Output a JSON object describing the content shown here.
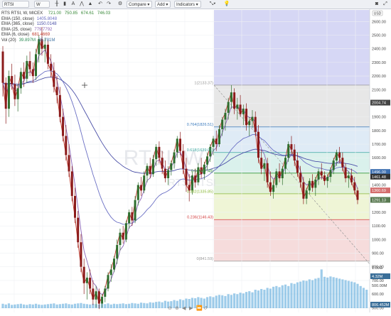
{
  "toolbar": {
    "symbol": "RTSI",
    "interval": "W",
    "compare_label": "Compare",
    "add_label": "Add",
    "indicators_label": "Indicators"
  },
  "chart_title": {
    "name": "RTS RTSI, W, MICEX",
    "open": "721.00",
    "high": "750.85",
    "low": "674.61",
    "close": "746.03"
  },
  "watermark": "RTSI, W",
  "watermark2": "RTS RTSI",
  "price_axis_badge": "USD",
  "chart_data": {
    "type": "candlestick",
    "price_axis": {
      "range": [
        465,
        2685
      ],
      "ticks": [
        2600,
        2500,
        2400,
        2300,
        2200,
        2100,
        2000,
        1900,
        1800,
        1700,
        1600,
        1500,
        1400,
        1300,
        1200,
        1100,
        1000,
        900,
        800,
        700,
        600,
        500
      ],
      "tick_labels": [
        "2600.00",
        "2500.00",
        "2400.00",
        "2300.00",
        "2200.00",
        "2100.00",
        "2000.00",
        "1900.00",
        "1800.00",
        "1700.00",
        "1600.00",
        "1500.00",
        "1400.00",
        "1300.00",
        "1200.00",
        "1100.00",
        "1000.00",
        "900.00",
        "800.00",
        "700.00",
        "600.00",
        "500.00"
      ],
      "price_tags": [
        {
          "label": "2004.74",
          "value": 2004.74,
          "color": "#444444"
        },
        {
          "label": "1496.00",
          "value": 1496.0,
          "color": "#3d6fb0"
        },
        {
          "label": "1461.48",
          "value": 1461.48,
          "color": "#333333"
        },
        {
          "label": "1360.69",
          "value": 1360.69,
          "color": "#d46c6c"
        },
        {
          "label": "1291.13",
          "value": 1291.13,
          "color": "#5a7a52"
        }
      ]
    },
    "volume_axis": {
      "tick_labels": [
        "1.00G",
        "500.00M"
      ],
      "tags": [
        {
          "label": "4.32M",
          "color": "#3b6f99"
        },
        {
          "label": "806.452M",
          "color": "#3b6f99"
        }
      ]
    },
    "fibonacci": {
      "levels": [
        {
          "ratio": 1,
          "price": 2133.37,
          "label": "1(2133.37)",
          "color": "#999999"
        },
        {
          "ratio": 0.764,
          "price": 1826.51,
          "label": "0.764(1826.51)",
          "color": "#3a7abd"
        },
        {
          "ratio": 0.618,
          "price": 1639.01,
          "label": "0.618(1639.01)",
          "color": "#3aa7a0"
        },
        {
          "ratio": 0.5,
          "price": 1487.48,
          "label": "0.5(1487.48)",
          "color": "#3f9a3f"
        },
        {
          "ratio": 0.382,
          "price": 1335.85,
          "label": "0.382(1335.85)",
          "color": "#8ab838"
        },
        {
          "ratio": 0.236,
          "price": 1146.43,
          "label": "0.236(1146.43)",
          "color": "#d23c3c"
        },
        {
          "ratio": 0,
          "price": 841.59,
          "label": "0(841.59)",
          "color": "#999999"
        }
      ],
      "extension_top_price": 2685
    },
    "candles": [
      {
        "o": 2380,
        "h": 2420,
        "l": 2050,
        "c": 2150
      },
      {
        "o": 2150,
        "h": 2190,
        "l": 1850,
        "c": 1960
      },
      {
        "o": 1960,
        "h": 2240,
        "l": 1900,
        "c": 2200
      },
      {
        "o": 2200,
        "h": 2290,
        "l": 2100,
        "c": 2140
      },
      {
        "o": 2140,
        "h": 2210,
        "l": 1980,
        "c": 2030
      },
      {
        "o": 2030,
        "h": 2140,
        "l": 1940,
        "c": 2110
      },
      {
        "o": 2110,
        "h": 2260,
        "l": 2070,
        "c": 2230
      },
      {
        "o": 2230,
        "h": 2300,
        "l": 2120,
        "c": 2180
      },
      {
        "o": 2180,
        "h": 2350,
        "l": 2150,
        "c": 2310
      },
      {
        "o": 2310,
        "h": 2380,
        "l": 2200,
        "c": 2250
      },
      {
        "o": 2250,
        "h": 2300,
        "l": 2150,
        "c": 2200
      },
      {
        "o": 2200,
        "h": 2400,
        "l": 2170,
        "c": 2360
      },
      {
        "o": 2360,
        "h": 2500,
        "l": 2300,
        "c": 2470
      },
      {
        "o": 2470,
        "h": 2560,
        "l": 2350,
        "c": 2400
      },
      {
        "o": 2400,
        "h": 2480,
        "l": 2300,
        "c": 2430
      },
      {
        "o": 2430,
        "h": 2460,
        "l": 2250,
        "c": 2290
      },
      {
        "o": 2290,
        "h": 2360,
        "l": 2190,
        "c": 2240
      },
      {
        "o": 2240,
        "h": 2300,
        "l": 2080,
        "c": 2120
      },
      {
        "o": 2120,
        "h": 2200,
        "l": 2000,
        "c": 2060
      },
      {
        "o": 2060,
        "h": 2120,
        "l": 1860,
        "c": 1900
      },
      {
        "o": 1900,
        "h": 1960,
        "l": 1720,
        "c": 1760
      },
      {
        "o": 1760,
        "h": 1840,
        "l": 1580,
        "c": 1620
      },
      {
        "o": 1620,
        "h": 1700,
        "l": 1460,
        "c": 1500
      },
      {
        "o": 1500,
        "h": 1540,
        "l": 1280,
        "c": 1320
      },
      {
        "o": 1320,
        "h": 1380,
        "l": 1120,
        "c": 1160
      },
      {
        "o": 1160,
        "h": 1210,
        "l": 940,
        "c": 980
      },
      {
        "o": 980,
        "h": 1040,
        "l": 760,
        "c": 800
      },
      {
        "o": 800,
        "h": 860,
        "l": 600,
        "c": 680
      },
      {
        "o": 680,
        "h": 760,
        "l": 560,
        "c": 720
      },
      {
        "o": 720,
        "h": 780,
        "l": 600,
        "c": 640
      },
      {
        "o": 640,
        "h": 700,
        "l": 520,
        "c": 560
      },
      {
        "o": 560,
        "h": 660,
        "l": 500,
        "c": 620
      },
      {
        "o": 620,
        "h": 640,
        "l": 490,
        "c": 530
      },
      {
        "o": 530,
        "h": 600,
        "l": 500,
        "c": 580
      },
      {
        "o": 580,
        "h": 660,
        "l": 540,
        "c": 640
      },
      {
        "o": 640,
        "h": 760,
        "l": 620,
        "c": 740
      },
      {
        "o": 740,
        "h": 820,
        "l": 690,
        "c": 780
      },
      {
        "o": 780,
        "h": 880,
        "l": 760,
        "c": 860
      },
      {
        "o": 860,
        "h": 1000,
        "l": 820,
        "c": 960
      },
      {
        "o": 960,
        "h": 1080,
        "l": 920,
        "c": 1050
      },
      {
        "o": 1050,
        "h": 1100,
        "l": 970,
        "c": 1000
      },
      {
        "o": 1000,
        "h": 1140,
        "l": 980,
        "c": 1120
      },
      {
        "o": 1120,
        "h": 1220,
        "l": 1080,
        "c": 1200
      },
      {
        "o": 1200,
        "h": 1240,
        "l": 1100,
        "c": 1140
      },
      {
        "o": 1140,
        "h": 1320,
        "l": 1120,
        "c": 1290
      },
      {
        "o": 1290,
        "h": 1420,
        "l": 1250,
        "c": 1400
      },
      {
        "o": 1400,
        "h": 1460,
        "l": 1320,
        "c": 1360
      },
      {
        "o": 1360,
        "h": 1500,
        "l": 1340,
        "c": 1470
      },
      {
        "o": 1470,
        "h": 1560,
        "l": 1420,
        "c": 1540
      },
      {
        "o": 1540,
        "h": 1600,
        "l": 1450,
        "c": 1480
      },
      {
        "o": 1480,
        "h": 1620,
        "l": 1460,
        "c": 1590
      },
      {
        "o": 1590,
        "h": 1700,
        "l": 1540,
        "c": 1680
      },
      {
        "o": 1680,
        "h": 1720,
        "l": 1560,
        "c": 1600
      },
      {
        "o": 1600,
        "h": 1650,
        "l": 1480,
        "c": 1520
      },
      {
        "o": 1520,
        "h": 1580,
        "l": 1420,
        "c": 1450
      },
      {
        "o": 1450,
        "h": 1540,
        "l": 1400,
        "c": 1510
      },
      {
        "o": 1510,
        "h": 1580,
        "l": 1470,
        "c": 1560
      },
      {
        "o": 1560,
        "h": 1660,
        "l": 1520,
        "c": 1640
      },
      {
        "o": 1640,
        "h": 1760,
        "l": 1600,
        "c": 1740
      },
      {
        "o": 1740,
        "h": 1790,
        "l": 1620,
        "c": 1650
      },
      {
        "o": 1650,
        "h": 1700,
        "l": 1480,
        "c": 1520
      },
      {
        "o": 1520,
        "h": 1600,
        "l": 1350,
        "c": 1400
      },
      {
        "o": 1400,
        "h": 1480,
        "l": 1280,
        "c": 1360
      },
      {
        "o": 1360,
        "h": 1500,
        "l": 1330,
        "c": 1470
      },
      {
        "o": 1470,
        "h": 1520,
        "l": 1380,
        "c": 1420
      },
      {
        "o": 1420,
        "h": 1560,
        "l": 1400,
        "c": 1530
      },
      {
        "o": 1530,
        "h": 1600,
        "l": 1450,
        "c": 1480
      },
      {
        "o": 1480,
        "h": 1570,
        "l": 1440,
        "c": 1550
      },
      {
        "o": 1550,
        "h": 1640,
        "l": 1510,
        "c": 1610
      },
      {
        "o": 1610,
        "h": 1700,
        "l": 1570,
        "c": 1680
      },
      {
        "o": 1680,
        "h": 1760,
        "l": 1620,
        "c": 1740
      },
      {
        "o": 1740,
        "h": 1800,
        "l": 1650,
        "c": 1700
      },
      {
        "o": 1700,
        "h": 1840,
        "l": 1680,
        "c": 1810
      },
      {
        "o": 1810,
        "h": 1900,
        "l": 1760,
        "c": 1880
      },
      {
        "o": 1880,
        "h": 1960,
        "l": 1800,
        "c": 1930
      },
      {
        "o": 1930,
        "h": 2040,
        "l": 1880,
        "c": 2010
      },
      {
        "o": 2010,
        "h": 2133,
        "l": 1960,
        "c": 2080
      },
      {
        "o": 2080,
        "h": 2110,
        "l": 1920,
        "c": 1960
      },
      {
        "o": 1960,
        "h": 2040,
        "l": 1880,
        "c": 1990
      },
      {
        "o": 1990,
        "h": 2060,
        "l": 1900,
        "c": 1920
      },
      {
        "o": 1920,
        "h": 1990,
        "l": 1840,
        "c": 1960
      },
      {
        "o": 1960,
        "h": 2000,
        "l": 1800,
        "c": 1840
      },
      {
        "o": 1840,
        "h": 1900,
        "l": 1760,
        "c": 1870
      },
      {
        "o": 1870,
        "h": 1950,
        "l": 1820,
        "c": 1900
      },
      {
        "o": 1900,
        "h": 1940,
        "l": 1760,
        "c": 1790
      },
      {
        "o": 1790,
        "h": 1840,
        "l": 1560,
        "c": 1600
      },
      {
        "o": 1600,
        "h": 1660,
        "l": 1480,
        "c": 1520
      },
      {
        "o": 1520,
        "h": 1590,
        "l": 1430,
        "c": 1560
      },
      {
        "o": 1560,
        "h": 1600,
        "l": 1380,
        "c": 1420
      },
      {
        "o": 1420,
        "h": 1500,
        "l": 1320,
        "c": 1350
      },
      {
        "o": 1350,
        "h": 1440,
        "l": 1300,
        "c": 1400
      },
      {
        "o": 1400,
        "h": 1520,
        "l": 1380,
        "c": 1500
      },
      {
        "o": 1500,
        "h": 1560,
        "l": 1420,
        "c": 1450
      },
      {
        "o": 1450,
        "h": 1540,
        "l": 1400,
        "c": 1520
      },
      {
        "o": 1520,
        "h": 1620,
        "l": 1480,
        "c": 1600
      },
      {
        "o": 1600,
        "h": 1720,
        "l": 1570,
        "c": 1700
      },
      {
        "o": 1700,
        "h": 1760,
        "l": 1620,
        "c": 1660
      },
      {
        "o": 1660,
        "h": 1700,
        "l": 1540,
        "c": 1580
      },
      {
        "o": 1580,
        "h": 1640,
        "l": 1460,
        "c": 1490
      },
      {
        "o": 1490,
        "h": 1540,
        "l": 1380,
        "c": 1420
      },
      {
        "o": 1420,
        "h": 1460,
        "l": 1260,
        "c": 1300
      },
      {
        "o": 1300,
        "h": 1380,
        "l": 1260,
        "c": 1360
      },
      {
        "o": 1360,
        "h": 1450,
        "l": 1330,
        "c": 1430
      },
      {
        "o": 1430,
        "h": 1480,
        "l": 1350,
        "c": 1380
      },
      {
        "o": 1380,
        "h": 1460,
        "l": 1320,
        "c": 1440
      },
      {
        "o": 1440,
        "h": 1520,
        "l": 1400,
        "c": 1500
      },
      {
        "o": 1500,
        "h": 1560,
        "l": 1440,
        "c": 1470
      },
      {
        "o": 1470,
        "h": 1500,
        "l": 1400,
        "c": 1430
      },
      {
        "o": 1430,
        "h": 1480,
        "l": 1380,
        "c": 1460
      },
      {
        "o": 1460,
        "h": 1530,
        "l": 1420,
        "c": 1510
      },
      {
        "o": 1510,
        "h": 1600,
        "l": 1480,
        "c": 1580
      },
      {
        "o": 1580,
        "h": 1660,
        "l": 1540,
        "c": 1640
      },
      {
        "o": 1640,
        "h": 1680,
        "l": 1560,
        "c": 1600
      },
      {
        "o": 1600,
        "h": 1640,
        "l": 1500,
        "c": 1530
      },
      {
        "o": 1530,
        "h": 1560,
        "l": 1420,
        "c": 1450
      },
      {
        "o": 1450,
        "h": 1500,
        "l": 1380,
        "c": 1470
      },
      {
        "o": 1470,
        "h": 1520,
        "l": 1400,
        "c": 1420
      },
      {
        "o": 1420,
        "h": 1460,
        "l": 1330,
        "c": 1360
      },
      {
        "o": 1360,
        "h": 1380,
        "l": 1260,
        "c": 1291
      }
    ],
    "volume": [
      0.12,
      0.1,
      0.13,
      0.09,
      0.1,
      0.11,
      0.12,
      0.1,
      0.09,
      0.11,
      0.1,
      0.12,
      0.1,
      0.09,
      0.1,
      0.11,
      0.12,
      0.13,
      0.1,
      0.11,
      0.12,
      0.13,
      0.11,
      0.1,
      0.12,
      0.13,
      0.14,
      0.12,
      0.11,
      0.1,
      0.12,
      0.11,
      0.1,
      0.12,
      0.11,
      0.13,
      0.1,
      0.12,
      0.11,
      0.12,
      0.13,
      0.11,
      0.12,
      0.14,
      0.13,
      0.12,
      0.15,
      0.14,
      0.13,
      0.16,
      0.15,
      0.17,
      0.18,
      0.16,
      0.2,
      0.18,
      0.19,
      0.22,
      0.2,
      0.24,
      0.22,
      0.26,
      0.25,
      0.28,
      0.27,
      0.3,
      0.28,
      0.26,
      0.3,
      0.32,
      0.3,
      0.34,
      0.36,
      0.35,
      0.33,
      0.38,
      0.36,
      0.4,
      0.38,
      0.42,
      0.4,
      0.44,
      0.46,
      0.43,
      0.5,
      0.48,
      0.52,
      0.5,
      0.55,
      0.53,
      0.58,
      0.6,
      0.57,
      0.62,
      0.64,
      0.6,
      0.68,
      0.66,
      0.7,
      0.72,
      0.75,
      0.74,
      0.78,
      0.76,
      0.8,
      0.82,
      1.05,
      0.85,
      0.83,
      0.86,
      0.84,
      0.82,
      0.8,
      0.78,
      0.76,
      0.74,
      0.72,
      0.7,
      0.66,
      0.6,
      0.55,
      0.5
    ]
  },
  "legend": [
    {
      "label": "EMA (150, close)",
      "value": "1405.8048",
      "color": "#6a6fc4"
    },
    {
      "label": "EMA (365, close)",
      "value": "1150.0148",
      "color": "#4c51a8"
    },
    {
      "label": "EMA (25, close)",
      "value": "779.7792",
      "color": "#8a64b6"
    },
    {
      "label": "EMA (6, close)",
      "value": "681.4669",
      "color": "#c0392b"
    },
    {
      "label": "Vol (20)",
      "value": "39.897M",
      "value2": "35.781M",
      "color": "#2e8b57",
      "color2": "#3b6fa0"
    }
  ],
  "colors": {
    "up": "#2e6e2e",
    "down": "#8b1a1a",
    "volume": "#4fa3d9"
  }
}
